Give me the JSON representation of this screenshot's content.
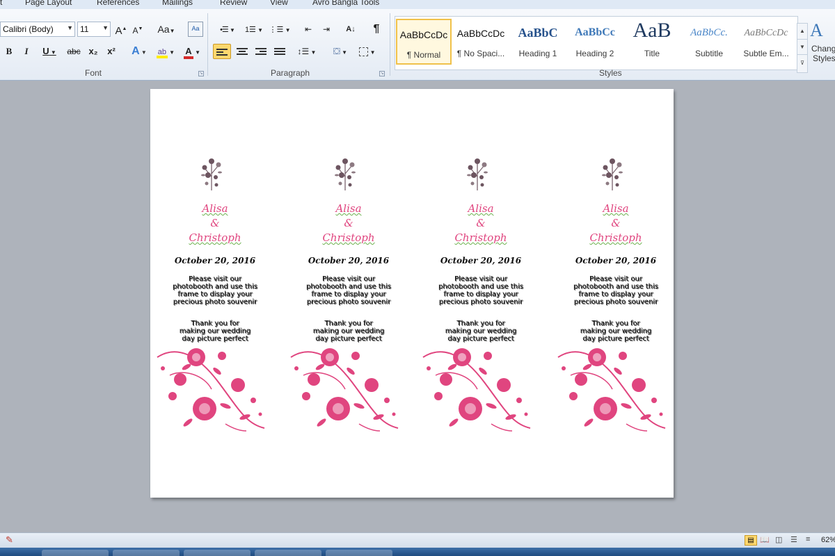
{
  "ribbon": {
    "tabs": [
      "t",
      "Page Layout",
      "References",
      "Mailings",
      "Review",
      "View",
      "Avro Bangla Tools"
    ],
    "font": {
      "font_name": "Calibri (Body)",
      "font_size": "11",
      "grow_label": "A",
      "shrink_label": "A",
      "case_label": "Aa",
      "bold": "B",
      "italic": "I",
      "underline": "U",
      "strike": "abc",
      "subscript": "x₂",
      "superscript": "x²",
      "group_label": "Font"
    },
    "paragraph": {
      "pilcrow": "¶",
      "sort": "A↓",
      "group_label": "Paragraph"
    },
    "styles": {
      "items": [
        {
          "sample": "AaBbCcDc",
          "name": "¶ Normal",
          "selected": true
        },
        {
          "sample": "AaBbCcDc",
          "name": "¶ No Spaci...",
          "selected": false
        },
        {
          "sample": "AaBbC",
          "name": "Heading 1",
          "selected": false
        },
        {
          "sample": "AaBbCc",
          "name": "Heading 2",
          "selected": false
        },
        {
          "sample": "AaB",
          "name": "Title",
          "selected": false
        },
        {
          "sample": "AaBbCc.",
          "name": "Subtitle",
          "selected": false
        },
        {
          "sample": "AaBbCcDc",
          "name": "Subtle Em...",
          "selected": false
        }
      ],
      "change_styles_line1": "Chang",
      "change_styles_line2": "Styles",
      "group_label": "Styles"
    }
  },
  "document": {
    "cards": [
      {
        "name1": "Alisa",
        "amp": "&",
        "name2": "Christoph",
        "date": "October 20, 2016",
        "message": "Please visit our\nphotobooth and use this\nframe to display your\nprecious photo souvenir",
        "thanks": "Thank you for\nmaking our wedding\nday picture perfect"
      },
      {
        "name1": "Alisa",
        "amp": "&",
        "name2": "Christoph",
        "date": "October 20, 2016",
        "message": "Please visit our\nphotobooth and use this\nframe to display your\nprecious photo souvenir",
        "thanks": "Thank you for\nmaking our wedding\nday picture perfect"
      },
      {
        "name1": "Alisa",
        "amp": "&",
        "name2": "Christoph",
        "date": "October 20, 2016",
        "message": "Please visit our\nphotobooth and use this\nframe to display your\nprecious photo souvenir",
        "thanks": "Thank you for\nmaking our wedding\nday picture perfect"
      },
      {
        "name1": "Alisa",
        "amp": "&",
        "name2": "Christoph",
        "date": "October 20, 2016",
        "message": "Please visit our\nphotobooth and use this\nframe to display your\nprecious photo souvenir",
        "thanks": "Thank you for\nmaking our wedding\nday picture perfect"
      }
    ]
  },
  "statusbar": {
    "zoom": "62%"
  },
  "colors": {
    "accent_pink": "#e0457f",
    "bouquet_gray": "#6d5560",
    "selected_style_border": "#f0c14a"
  }
}
